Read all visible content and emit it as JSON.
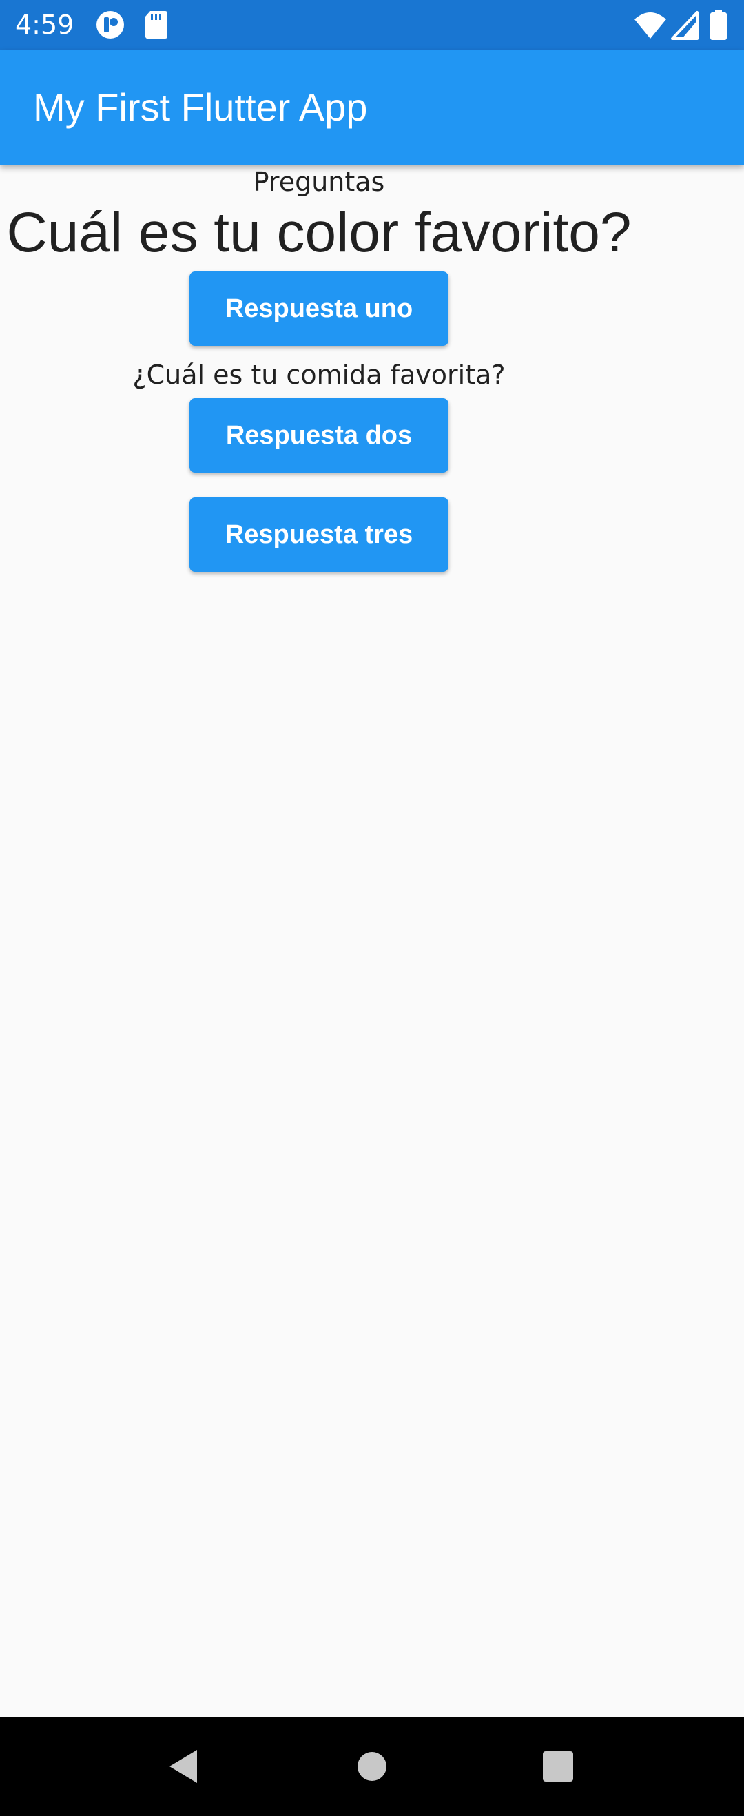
{
  "status_bar": {
    "time": "4:59",
    "icons": [
      "app-notification-icon",
      "sd-card-icon",
      "wifi-icon",
      "cell-signal-icon",
      "battery-icon"
    ]
  },
  "app_bar": {
    "title": "My First Flutter App"
  },
  "content": {
    "section_label": "Preguntas",
    "question_main": "Cuál es tu color favorito?",
    "question_secondary": "¿Cuál es tu comida favorita?",
    "buttons": [
      {
        "label": "Respuesta uno"
      },
      {
        "label": "Respuesta dos"
      },
      {
        "label": "Respuesta tres"
      }
    ]
  },
  "nav_bar": {
    "icons": [
      "back-icon",
      "home-icon",
      "recents-icon"
    ]
  },
  "colors": {
    "status_bar": "#1976d2",
    "app_bar": "#2196f3",
    "button": "#2196f3",
    "background": "#fafafa"
  }
}
